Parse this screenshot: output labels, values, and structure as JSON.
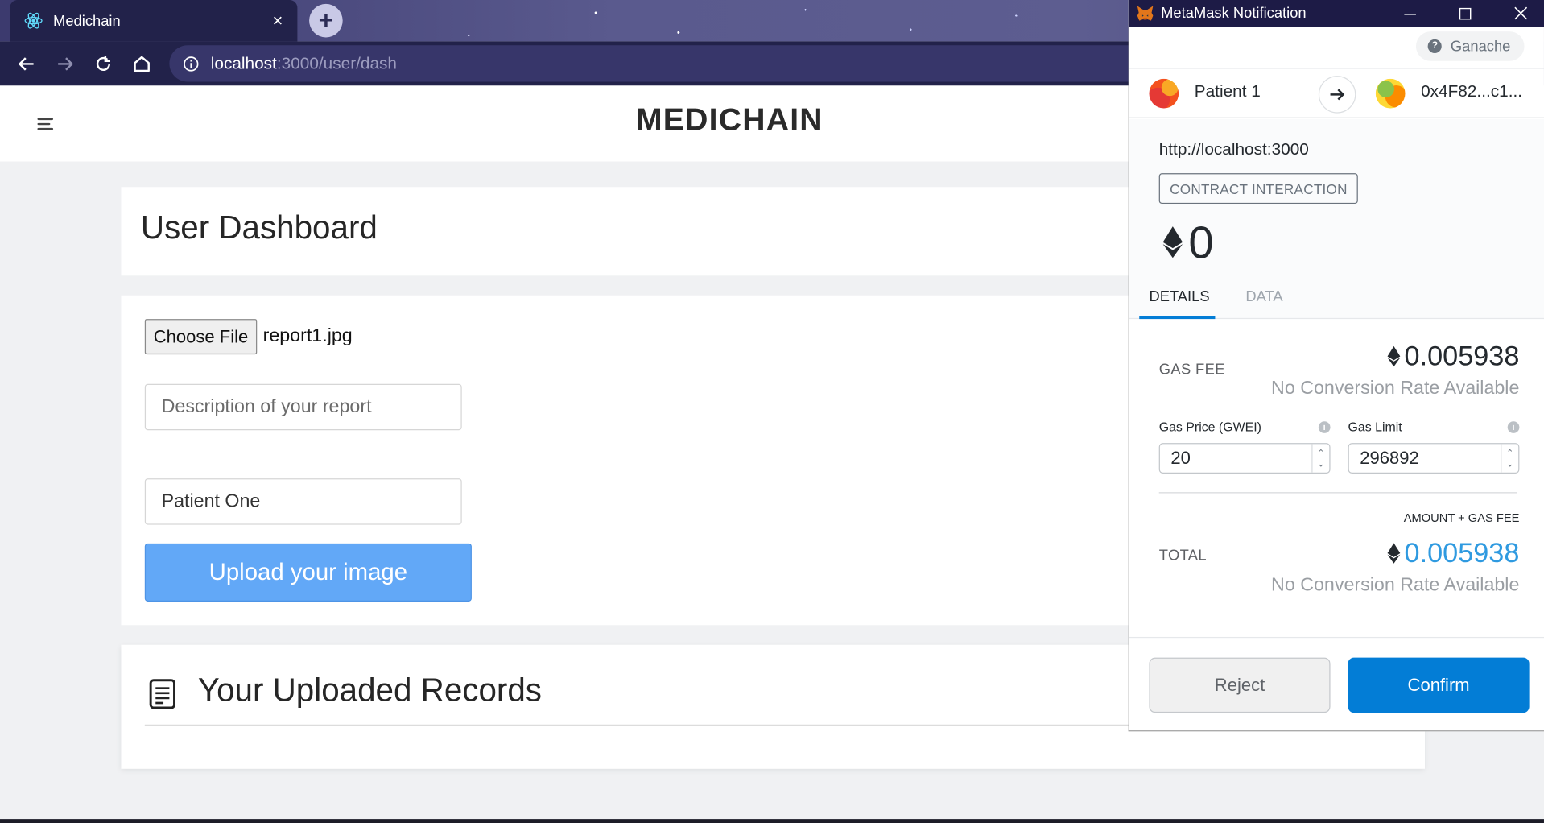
{
  "browser": {
    "tab_title": "Medichain",
    "tab_close": "×",
    "new_tab": "+",
    "url_host": "localhost",
    "url_path": ":3000/user/dash"
  },
  "app": {
    "brand": "MEDICHAIN",
    "dashboard_title": "User Dashboard",
    "file_button": "Choose File",
    "file_name": "report1.jpg",
    "description_placeholder": "Description of your report",
    "name_value": "Patient One",
    "upload_button": "Upload your image",
    "records_title": "Your Uploaded Records"
  },
  "metamask": {
    "window_title": "MetaMask Notification",
    "network": "Ganache",
    "from_account": "Patient 1",
    "to_address": "0x4F82...c1...",
    "origin": "http://localhost:3000",
    "action": "CONTRACT INTERACTION",
    "amount": "0",
    "tabs": [
      "DETAILS",
      "DATA"
    ],
    "gas_fee_label": "GAS FEE",
    "gas_fee_value": "0.005938",
    "gas_fee_conversion": "No Conversion Rate Available",
    "gas_price_label": "Gas Price (GWEI)",
    "gas_price_value": "20",
    "gas_limit_label": "Gas Limit",
    "gas_limit_value": "296892",
    "amount_plus_gas_label": "AMOUNT + GAS FEE",
    "total_label": "TOTAL",
    "total_value": "0.005938",
    "total_conversion": "No Conversion Rate Available",
    "reject_button": "Reject",
    "confirm_button": "Confirm"
  },
  "colors": {
    "browser_dark": "#22224a",
    "upload_button": "#62a8f7",
    "metamask_blue": "#037dd6",
    "total_value": "#2f9ae0"
  }
}
